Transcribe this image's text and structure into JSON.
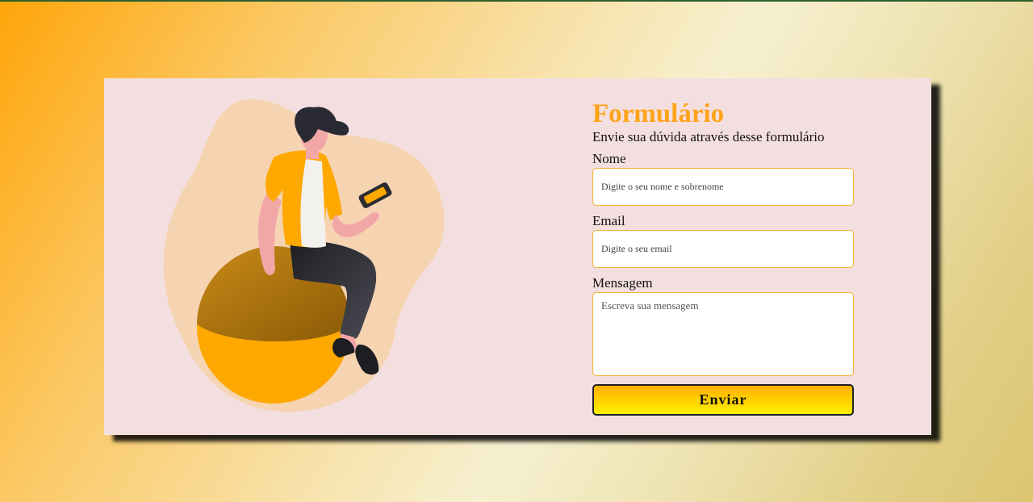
{
  "form": {
    "title": "Formulário",
    "subtitle": "Envie sua dúvida através desse formulário",
    "name_label": "Nome",
    "name_placeholder": "Digite o seu nome e sobrenome",
    "email_label": "Email",
    "email_placeholder": "Digite o seu email",
    "message_label": "Mensagem",
    "message_placeholder": "Escreva sua mensagem",
    "submit_label": "Enviar"
  },
  "colors": {
    "accent": "#ffa31a",
    "card_background": "#f4dfe0",
    "input_border": "#f2b233",
    "button_gradient_top": "#ffb000",
    "button_gradient_bottom": "#fff000"
  },
  "illustration": {
    "icon": "person-sitting-on-ball-with-phone-illustration"
  }
}
